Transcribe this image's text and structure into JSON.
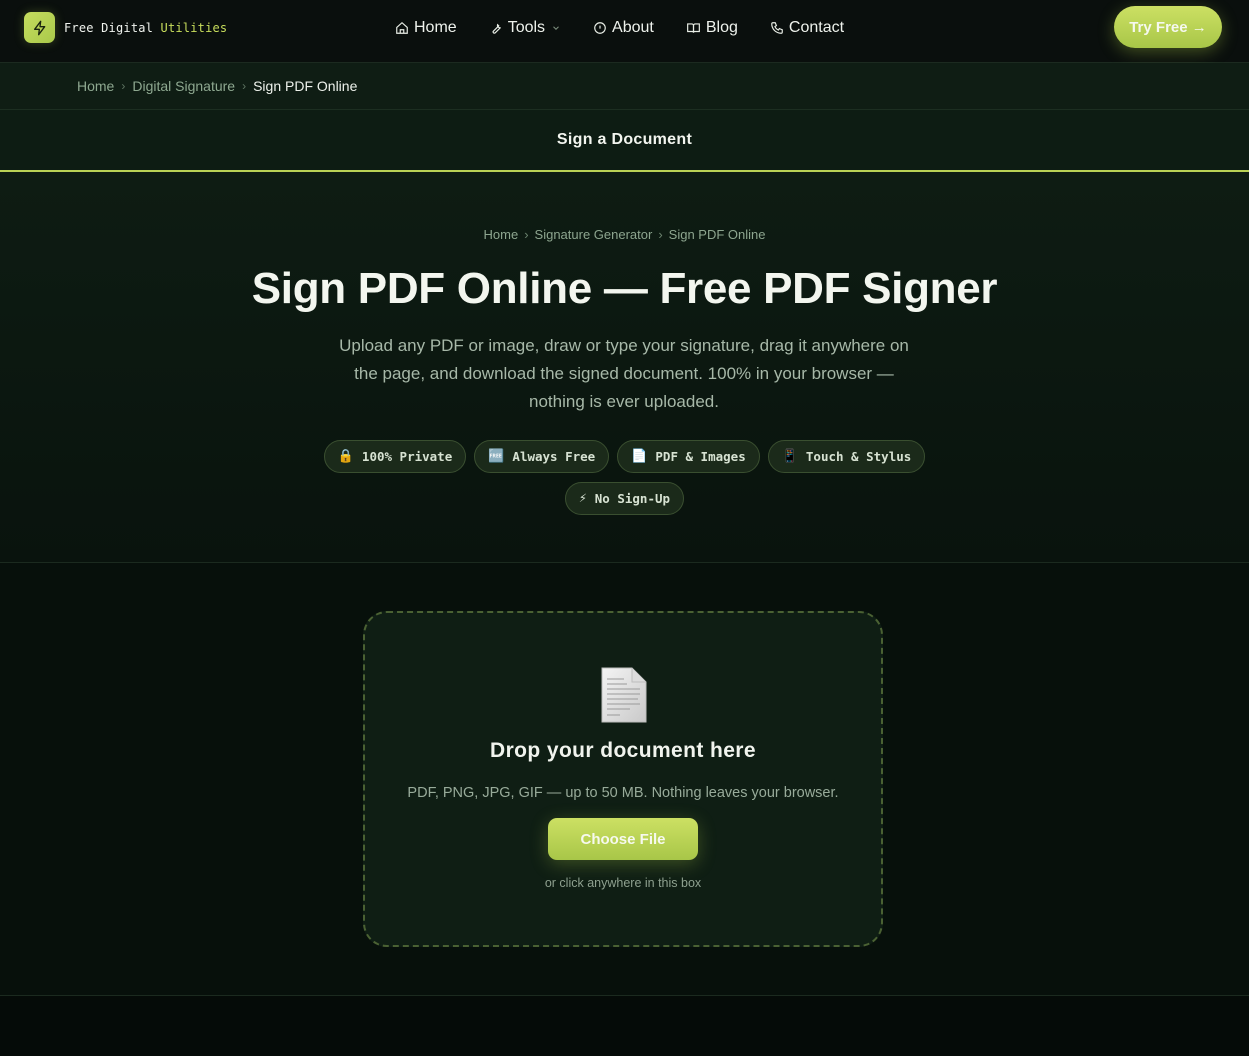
{
  "brand": {
    "name_main": "Free Digital ",
    "name_accent": "Utilities",
    "logo_icon": "lightning-bolt-icon"
  },
  "nav": {
    "items": [
      {
        "label": "Home",
        "icon": "home-icon"
      },
      {
        "label": "Tools",
        "icon": "wrench-icon",
        "has_dropdown": true
      },
      {
        "label": "About",
        "icon": "info-icon"
      },
      {
        "label": "Blog",
        "icon": "book-icon"
      },
      {
        "label": "Contact",
        "icon": "phone-icon"
      }
    ],
    "cta_label": "Try Free →"
  },
  "breadcrumb": {
    "items": [
      "Home",
      "Digital Signature",
      "Sign PDF Online"
    ],
    "separator": "›"
  },
  "section_title": "Sign a Document",
  "hero": {
    "breadcrumb": [
      "Home",
      "Signature Generator",
      "Sign PDF Online"
    ],
    "separator": "›",
    "title": "Sign PDF Online — Free PDF Signer",
    "description": "Upload any PDF or image, draw or type your signature, drag it anywhere on the page, and download the signed document. 100% in your browser — nothing is ever uploaded.",
    "badges": [
      {
        "icon": "🔒",
        "label": "100% Private"
      },
      {
        "icon": "🆓",
        "label": "Always Free"
      },
      {
        "icon": "📄",
        "label": "PDF & Images"
      },
      {
        "icon": "📱",
        "label": "Touch & Stylus"
      },
      {
        "icon": "⚡",
        "label": "No Sign-Up"
      }
    ]
  },
  "upload": {
    "icon": "document-icon",
    "title": "Drop your document here",
    "subtitle": "PDF, PNG, JPG, GIF — up to 50 MB. Nothing leaves your browser.",
    "button_label": "Choose File",
    "hint": "or click anywhere in this box"
  },
  "colors": {
    "accent": "#c6dd5f",
    "background": "#070d0a",
    "panel": "#0f1e14"
  }
}
